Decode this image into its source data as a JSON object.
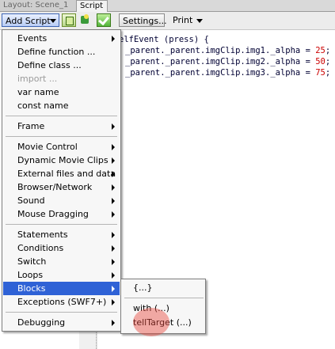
{
  "tabs": [
    {
      "label": "Layout: Scene_1"
    },
    {
      "label": "Script"
    }
  ],
  "toolbar": {
    "add_script_label": "Add Script",
    "settings_label": "Settings...",
    "print_label": "Print",
    "icons": [
      "script-view-icon",
      "insert-object-icon",
      "check-syntax-icon"
    ]
  },
  "code": {
    "lines": [
      "elfEvent (press) {",
      "_parent._parent.imgClip.img1._alpha = ",
      "_parent._parent.imgClip.img2._alpha = ",
      "_parent._parent.imgClip.img3._alpha = "
    ],
    "values": [
      "25",
      "50",
      "75"
    ],
    "terminator": ";"
  },
  "add_script_menu": {
    "items": [
      {
        "label": "Events",
        "has_submenu": true
      },
      {
        "label": "Define function ...",
        "has_submenu": false
      },
      {
        "label": "Define class ...",
        "has_submenu": false
      },
      {
        "label": "import ...",
        "has_submenu": false,
        "disabled": true
      },
      {
        "label": "var name",
        "has_submenu": false
      },
      {
        "label": "const name",
        "has_submenu": false
      },
      {
        "label": "Frame",
        "has_submenu": true
      },
      {
        "label": "Movie Control",
        "has_submenu": true
      },
      {
        "label": "Dynamic Movie Clips",
        "has_submenu": true
      },
      {
        "label": "External files and data",
        "has_submenu": true
      },
      {
        "label": "Browser/Network",
        "has_submenu": true
      },
      {
        "label": "Sound",
        "has_submenu": true
      },
      {
        "label": "Mouse Dragging",
        "has_submenu": true
      },
      {
        "label": "Statements",
        "has_submenu": true
      },
      {
        "label": "Conditions",
        "has_submenu": true
      },
      {
        "label": "Switch",
        "has_submenu": true
      },
      {
        "label": "Loops",
        "has_submenu": true
      },
      {
        "label": "Blocks",
        "has_submenu": true,
        "selected": true
      },
      {
        "label": "Exceptions (SWF7+)",
        "has_submenu": true
      },
      {
        "label": "Debugging",
        "has_submenu": true
      }
    ]
  },
  "blocks_submenu": {
    "items": [
      {
        "label": "{...}"
      },
      {
        "label": "with (...)"
      },
      {
        "label": "tellTarget (...)"
      }
    ]
  },
  "colors": {
    "selection": "#2f62d6",
    "code_number": "#cc0000",
    "click_highlight": "#e6463c"
  }
}
